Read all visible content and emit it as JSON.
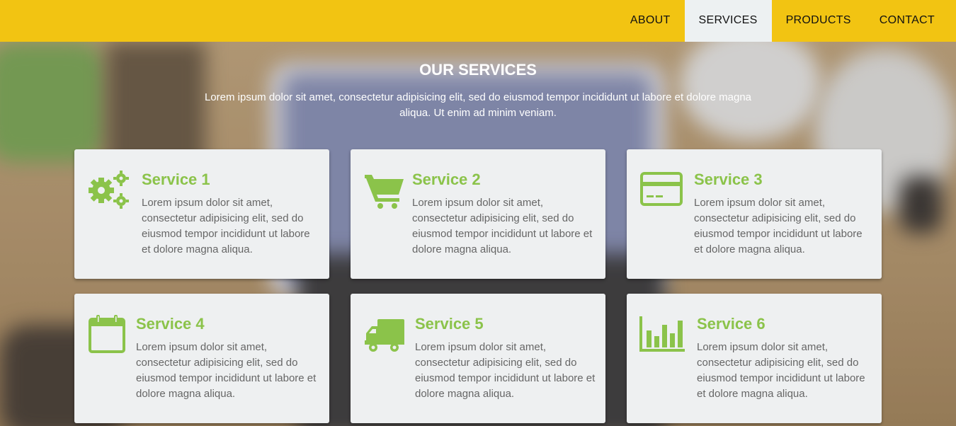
{
  "nav": {
    "items": [
      {
        "label": "ABOUT",
        "active": false
      },
      {
        "label": "SERVICES",
        "active": true
      },
      {
        "label": "PRODUCTS",
        "active": false
      },
      {
        "label": "CONTACT",
        "active": false
      }
    ]
  },
  "header": {
    "title": "OUR SERVICES",
    "description": "Lorem ipsum dolor sit amet, consectetur adipisicing elit, sed do eiusmod tempor incididunt ut labore et dolore magna aliqua. Ut enim ad minim veniam."
  },
  "services": [
    {
      "title": "Service 1",
      "icon": "gears-icon",
      "text": "Lorem ipsum dolor sit amet, consectetur adipisicing elit, sed do eiusmod tempor incididunt ut labore et dolore magna aliqua."
    },
    {
      "title": "Service 2",
      "icon": "shopping-cart-icon",
      "text": "Lorem ipsum dolor sit amet, consectetur adipisicing elit, sed do eiusmod tempor incididunt ut labore et dolore magna aliqua."
    },
    {
      "title": "Service 3",
      "icon": "credit-card-icon",
      "text": "Lorem ipsum dolor sit amet, consectetur adipisicing elit, sed do eiusmod tempor incididunt ut labore et dolore magna aliqua."
    },
    {
      "title": "Service 4",
      "icon": "calendar-icon",
      "text": "Lorem ipsum dolor sit amet, consectetur adipisicing elit, sed do eiusmod tempor incididunt ut labore et dolore magna aliqua."
    },
    {
      "title": "Service 5",
      "icon": "truck-icon",
      "text": "Lorem ipsum dolor sit amet, consectetur adipisicing elit, sed do eiusmod tempor incididunt ut labore et dolore magna aliqua."
    },
    {
      "title": "Service 6",
      "icon": "bar-chart-icon",
      "text": "Lorem ipsum dolor sit amet, consectetur adipisicing elit, sed do eiusmod tempor incididunt ut labore et dolore magna aliqua."
    }
  ],
  "colors": {
    "navbar": "#f2c412",
    "accent": "#8bc34a",
    "card": "#eef0f1",
    "active_nav": "#edf1f2"
  }
}
